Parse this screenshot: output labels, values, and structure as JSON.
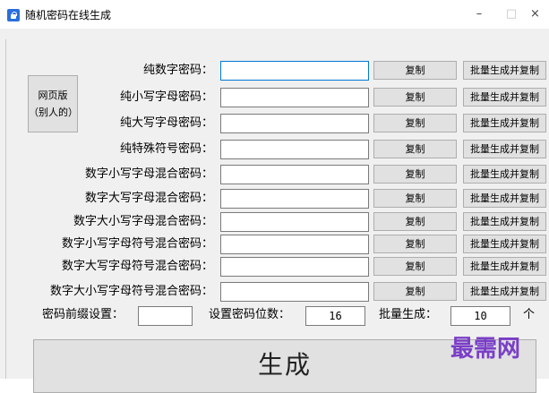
{
  "window": {
    "title": "随机密码在线生成",
    "minimize": "–",
    "maximize": "□",
    "close": "×"
  },
  "web_button": {
    "line1": "网页版",
    "line2": "（别人的）"
  },
  "copy_label": "复制",
  "batch_label": "批量生成并复制",
  "rows": [
    {
      "label": "纯数字密码："
    },
    {
      "label": "纯小写字母密码："
    },
    {
      "label": "纯大写字母密码："
    },
    {
      "label": "纯特殊符号密码："
    },
    {
      "label": "数字小写字母混合密码："
    },
    {
      "label": "数字大写字母混合密码："
    },
    {
      "label": "数字大小写字母混合密码："
    },
    {
      "label": "数字小写字母符号混合密码："
    },
    {
      "label": "数字大写字母符号混合密码："
    },
    {
      "label": "数字大小写字母符号混合密码："
    }
  ],
  "settings": {
    "prefix_label": "密码前缀设置：",
    "prefix_value": "",
    "length_label": "设置密码位数：",
    "length_value": "16",
    "batch_label": "批量生成：",
    "batch_value": "10",
    "batch_unit": "个"
  },
  "generate_label": "生成",
  "watermark": "最需网",
  "colors": {
    "accent": "#0078d7",
    "watermark": "#7a3ec8"
  }
}
